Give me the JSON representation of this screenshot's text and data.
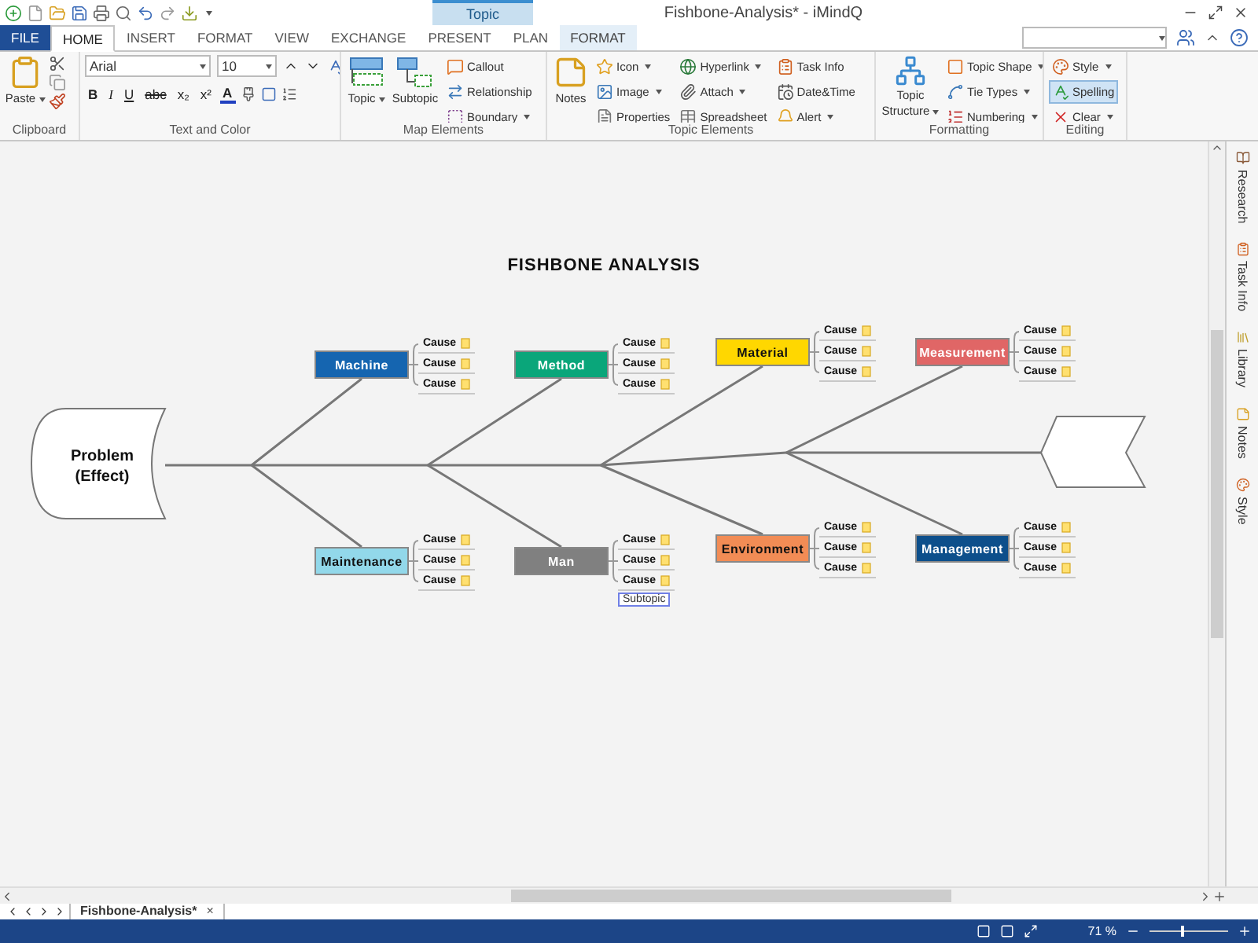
{
  "title_bar": {
    "context_tab": "Topic",
    "title": "Fishbone-Analysis* - iMindQ"
  },
  "tabs": [
    {
      "label": "FILE",
      "kind": "file",
      "selected": false
    },
    {
      "label": "HOME",
      "kind": "normal",
      "selected": true
    },
    {
      "label": "INSERT",
      "kind": "normal",
      "selected": false
    },
    {
      "label": "FORMAT",
      "kind": "normal",
      "selected": false
    },
    {
      "label": "VIEW",
      "kind": "normal",
      "selected": false
    },
    {
      "label": "EXCHANGE",
      "kind": "normal",
      "selected": false
    },
    {
      "label": "PRESENT",
      "kind": "normal",
      "selected": false
    },
    {
      "label": "PLAN",
      "kind": "normal",
      "selected": false
    },
    {
      "label": "FORMAT",
      "kind": "context",
      "selected": false
    }
  ],
  "ribbon": {
    "clipboard": {
      "label": "Clipboard",
      "paste": "Paste"
    },
    "text_and_color": {
      "label": "Text and Color",
      "font": "Arial",
      "size": "10",
      "format_buttons": [
        "B",
        "I",
        "U",
        "abc",
        "x₂",
        "x²"
      ],
      "font_color_letter": "A"
    },
    "map_elements": {
      "label": "Map Elements",
      "big": [
        {
          "label": "Topic",
          "dropdown": true
        },
        {
          "label": "Subtopic",
          "dropdown": false
        }
      ],
      "columns": [
        [
          {
            "label": "Callout",
            "dropdown": false
          },
          {
            "label": "Relationship",
            "dropdown": false
          },
          {
            "label": "Boundary",
            "dropdown": true
          }
        ]
      ]
    },
    "topic_elements": {
      "label": "Topic Elements",
      "big": [
        {
          "label": "Notes",
          "dropdown": false
        }
      ],
      "columns": [
        [
          {
            "label": "Icon",
            "dropdown": true
          },
          {
            "label": "Image",
            "dropdown": true
          },
          {
            "label": "Properties",
            "dropdown": false
          }
        ],
        [
          {
            "label": "Hyperlink",
            "dropdown": true
          },
          {
            "label": "Attach",
            "dropdown": true
          },
          {
            "label": "Spreadsheet",
            "dropdown": false
          }
        ],
        [
          {
            "label": "Task Info",
            "dropdown": false
          },
          {
            "label": "Date&Time",
            "dropdown": false
          },
          {
            "label": "Alert",
            "dropdown": true
          }
        ]
      ]
    },
    "formatting": {
      "label": "Formatting",
      "big": [
        {
          "label": "Topic Structure",
          "dropdown": true
        }
      ],
      "columns": [
        [
          {
            "label": "Topic Shape",
            "dropdown": true
          },
          {
            "label": "Tie Types",
            "dropdown": true
          },
          {
            "label": "Numbering",
            "dropdown": true
          }
        ]
      ]
    },
    "editing": {
      "label": "Editing",
      "columns": [
        [
          {
            "label": "Style",
            "dropdown": true,
            "selected": false
          },
          {
            "label": "Spelling",
            "dropdown": false,
            "selected": true
          },
          {
            "label": "Clear",
            "dropdown": true,
            "selected": false
          }
        ]
      ]
    }
  },
  "diagram": {
    "title": "FISHBONE ANALYSIS",
    "problem": [
      "Problem",
      "(Effect)"
    ],
    "bones": [
      {
        "top": {
          "name": "Machine",
          "color": "#1565b0",
          "causes": [
            "Cause",
            "Cause",
            "Cause"
          ]
        },
        "bottom": {
          "name": "Maintenance",
          "color": "#92d8ea",
          "causes": [
            "Cause",
            "Cause",
            "Cause"
          ]
        }
      },
      {
        "top": {
          "name": "Method",
          "color": "#0aa67a",
          "causes": [
            "Cause",
            "Cause",
            "Cause"
          ]
        },
        "bottom": {
          "name": "Man",
          "color": "#808080",
          "causes": [
            "Cause",
            "Cause",
            "Cause"
          ]
        }
      },
      {
        "top": {
          "name": "Material",
          "color": "#ffd700",
          "causes": [
            "Cause",
            "Cause",
            "Cause"
          ]
        },
        "bottom": {
          "name": "Environment",
          "color": "#f28c55",
          "causes": [
            "Cause",
            "Cause",
            "Cause"
          ]
        }
      },
      {
        "top": {
          "name": "Measurement",
          "color": "#e06666",
          "causes": [
            "Cause",
            "Cause",
            "Cause"
          ]
        },
        "bottom": {
          "name": "Management",
          "color": "#0d4f8b",
          "causes": [
            "Cause",
            "Cause",
            "Cause"
          ]
        }
      }
    ],
    "drag_label": "Subtopic"
  },
  "side_panel": [
    "Research",
    "Task Info",
    "Library",
    "Notes",
    "Style"
  ],
  "sheet_tabs": [
    {
      "label": "Fishbone-Analysis*",
      "selected": true,
      "close": "×"
    }
  ],
  "status_bar": {
    "zoom": "71 %",
    "level": 0.42
  }
}
